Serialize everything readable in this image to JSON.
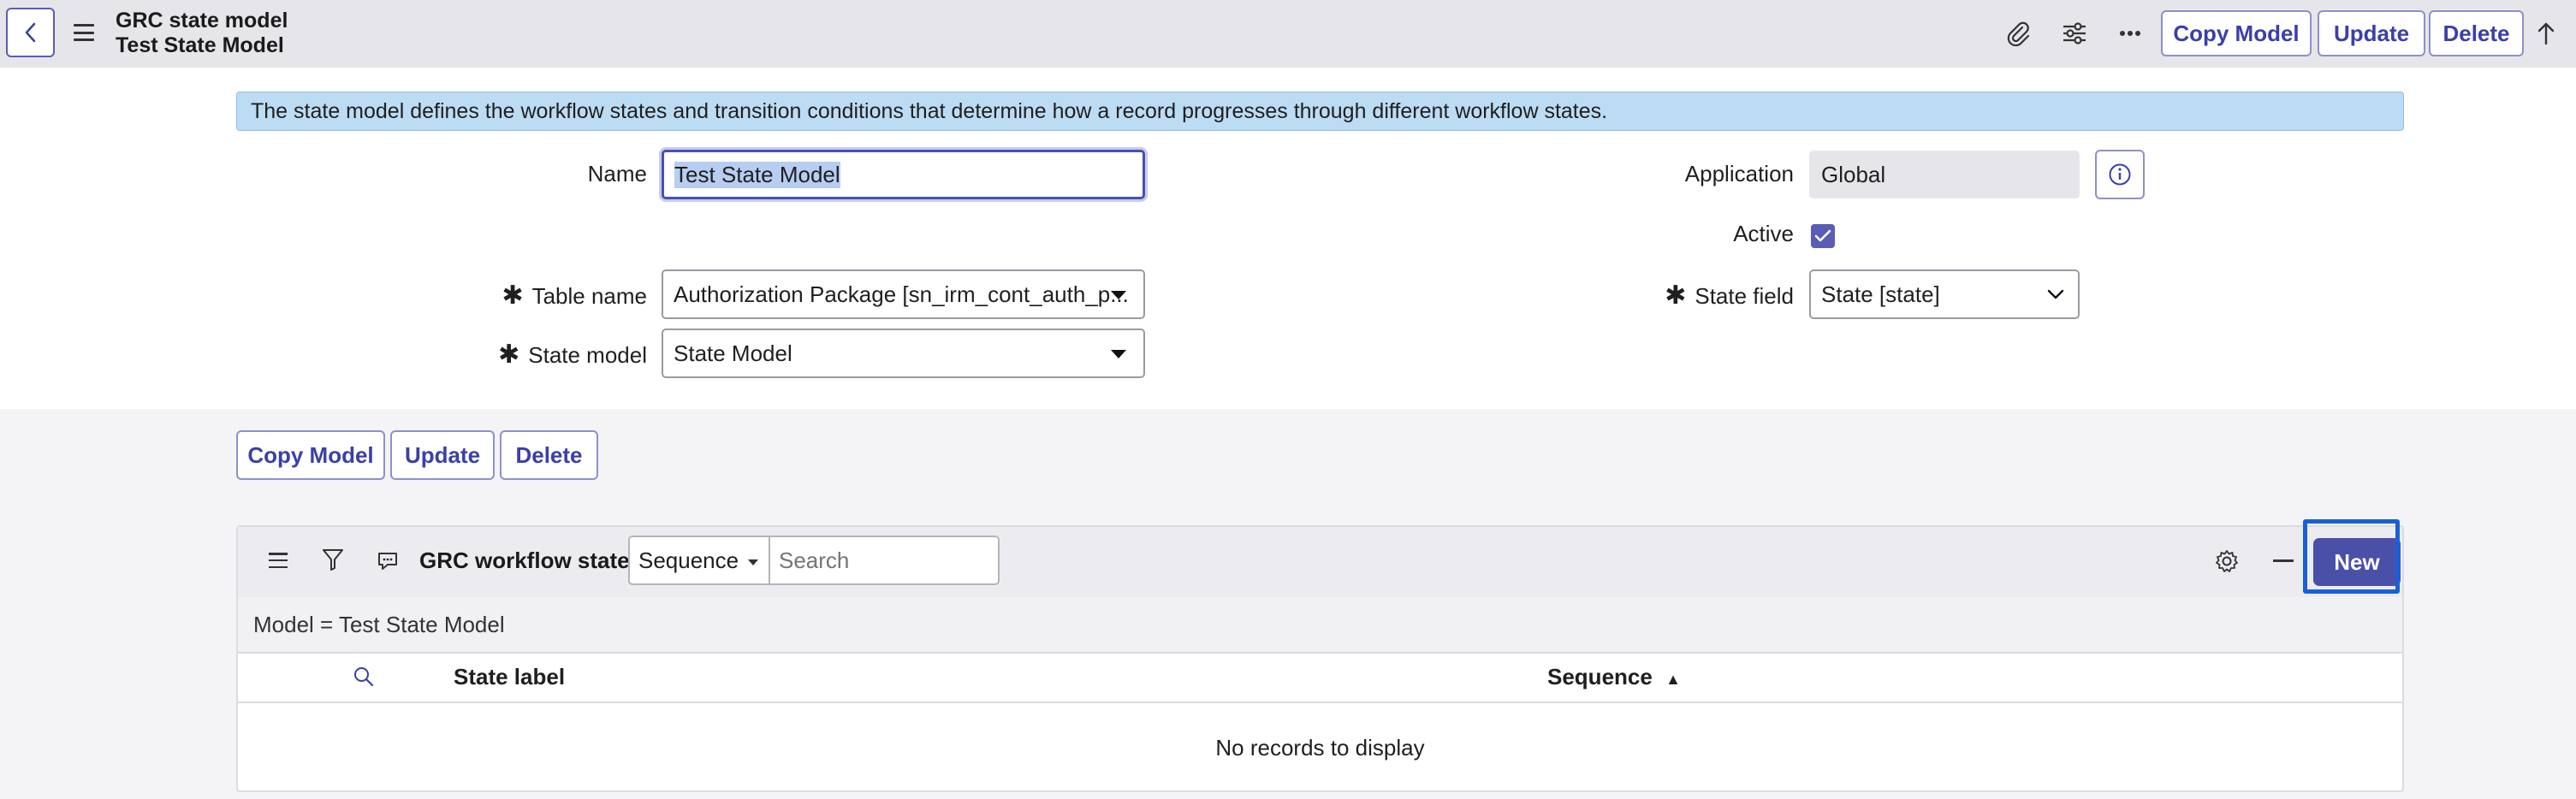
{
  "header": {
    "title_line1": "GRC state model",
    "title_line2": "Test State Model",
    "buttons": {
      "copy_model": "Copy Model",
      "update": "Update",
      "delete": "Delete"
    },
    "icons": [
      "back-icon",
      "hamburger-icon",
      "paperclip-icon",
      "sliders-icon",
      "more-icon",
      "arrow-up-icon"
    ]
  },
  "info_banner": "The state model defines the workflow states and transition conditions that determine how a record progresses through different workflow states.",
  "form": {
    "name_label": "Name",
    "name_value": "Test State Model",
    "application_label": "Application",
    "application_value": "Global",
    "active_label": "Active",
    "active_checked": true,
    "table_name_label": "Table name",
    "table_name_value": "Authorization Package [sn_irm_cont_auth_p...",
    "state_field_label": "State field",
    "state_field_value": "State [state]",
    "state_model_label": "State model",
    "state_model_value": "State Model",
    "required_mark": "✱"
  },
  "form_buttons": {
    "copy_model": "Copy Model",
    "update": "Update",
    "delete": "Delete"
  },
  "list": {
    "title": "GRC workflow states",
    "search_field_select": "Sequence",
    "search_placeholder": "Search",
    "breadcrumb": "Model = Test State Model",
    "columns": [
      "State label",
      "Sequence"
    ],
    "sort_indicator": "▲",
    "empty_message": "No records to display",
    "new_label": "New"
  },
  "colors": {
    "accent": "#4a4fa8",
    "highlight": "#1a5fd8",
    "banner": "#bcdcf3"
  }
}
